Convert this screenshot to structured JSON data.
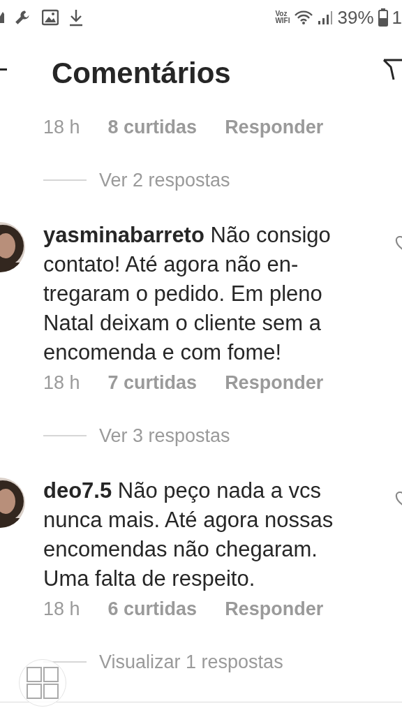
{
  "status_bar": {
    "network_top": "Voz",
    "network_bottom": "WIFI",
    "battery": "39%",
    "time": "1"
  },
  "header": {
    "title": "Comentários"
  },
  "thread": [
    {
      "kind": "meta",
      "time": "18 h",
      "likes": "8 curtidas",
      "reply": "Responder"
    },
    {
      "kind": "replies",
      "label": "Ver 2 respostas"
    },
    {
      "kind": "comment",
      "username": "yasminabarreto",
      "lines": [
        "Não consigo",
        "contato! Até agora não en-",
        "tregaram o pedido. Em pleno",
        "Natal deixam o cliente sem a",
        "encomenda e com fome!"
      ]
    },
    {
      "kind": "meta",
      "time": "18 h",
      "likes": "7 curtidas",
      "reply": "Responder"
    },
    {
      "kind": "replies",
      "label": "Ver 3 respostas"
    },
    {
      "kind": "comment",
      "username": "deo7.5",
      "lines": [
        "Não peço nada a vcs",
        "nunca mais. Até agora nossas",
        "encomendas não chegaram.",
        "Uma falta de respeito."
      ]
    },
    {
      "kind": "meta",
      "time": "18 h",
      "likes": "6 curtidas",
      "reply": "Responder"
    },
    {
      "kind": "replies",
      "label": "Visualizar 1 respostas"
    }
  ]
}
